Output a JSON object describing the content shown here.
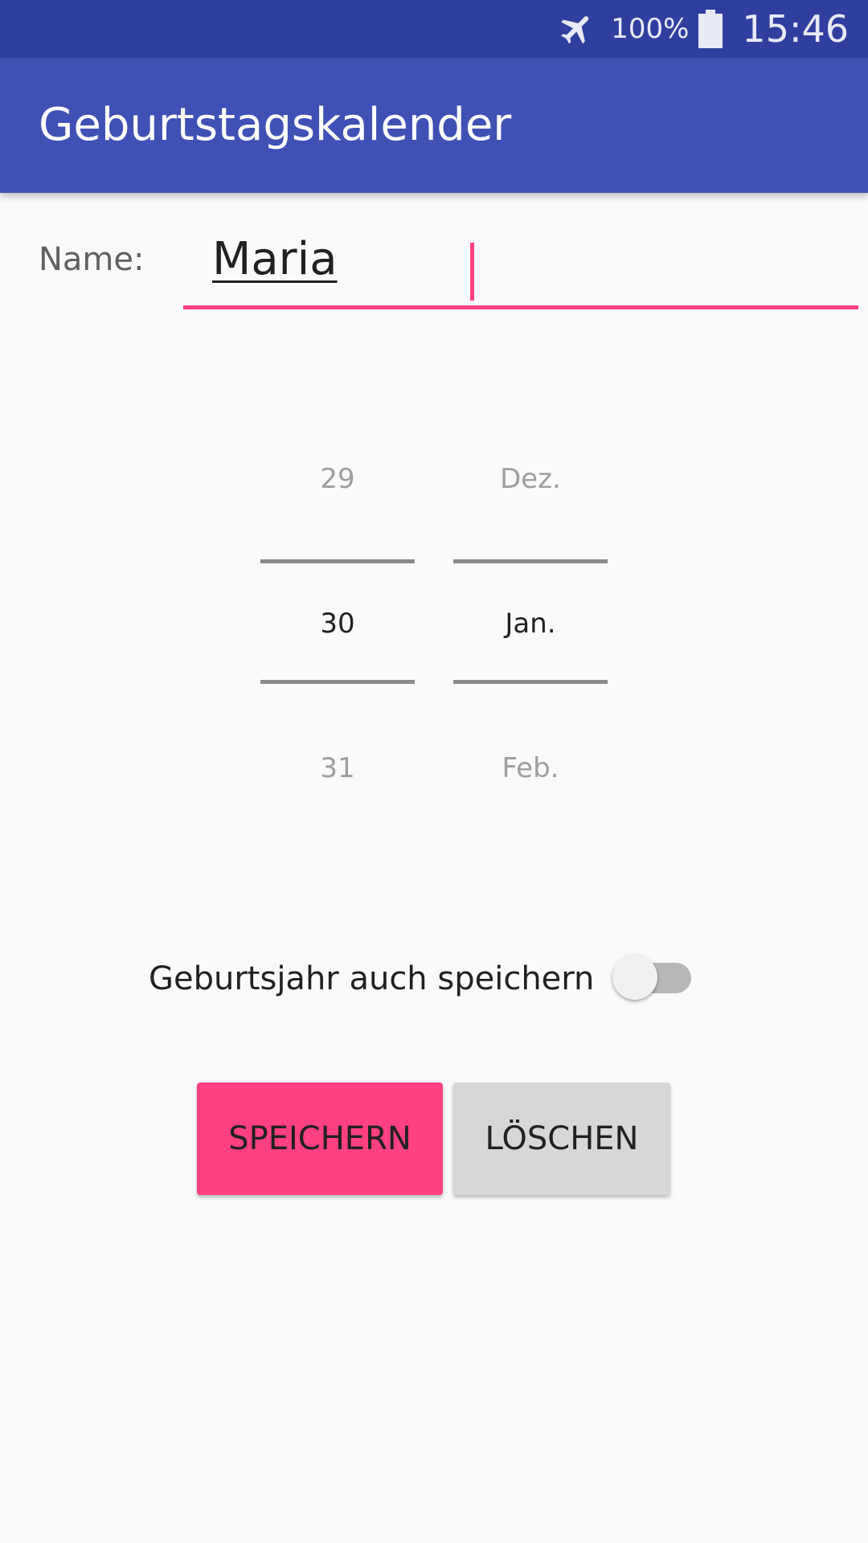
{
  "status_bar": {
    "battery": "100%",
    "time": "15:46",
    "icons": [
      "airplane-icon",
      "battery-icon"
    ]
  },
  "app_bar": {
    "title": "Geburtstagskalender"
  },
  "form": {
    "name_label": "Name:",
    "name_value": "Maria",
    "accent_color": "#ff4081"
  },
  "date_picker": {
    "day": {
      "prev": "29",
      "selected": "30",
      "next": "31"
    },
    "month": {
      "prev": "Dez.",
      "selected": "Jan.",
      "next": "Feb."
    }
  },
  "year_option": {
    "label": "Geburtsjahr auch speichern",
    "enabled": false
  },
  "buttons": {
    "save_label": "SPEICHERN",
    "delete_label": "LÖSCHEN"
  },
  "colors": {
    "status_bar": "#303f9f",
    "app_bar": "#3f51b5",
    "accent": "#ff4081",
    "background": "#fafafa"
  }
}
